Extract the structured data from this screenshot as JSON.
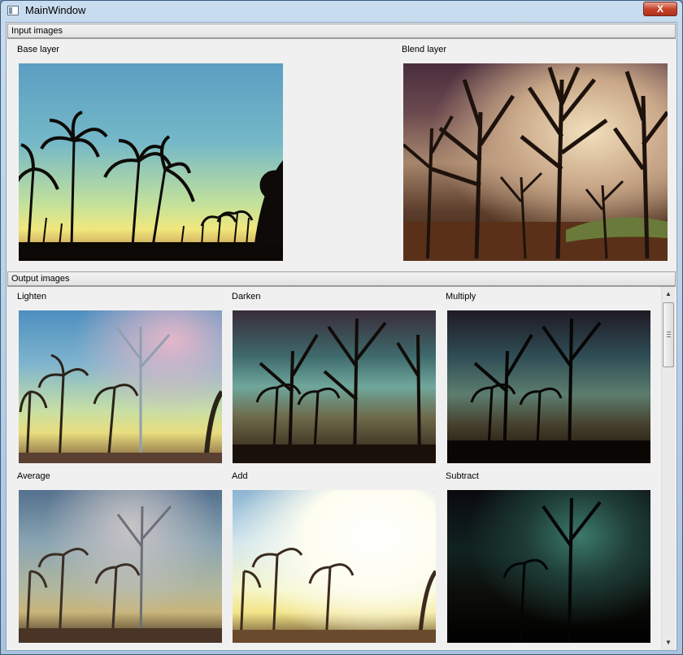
{
  "window": {
    "title": "MainWindow",
    "close_label": "X"
  },
  "input_section": {
    "header": "Input images",
    "base_label": "Base layer",
    "blend_label": "Blend layer"
  },
  "output_section": {
    "header": "Output images",
    "items": [
      {
        "label": "Lighten"
      },
      {
        "label": "Darken"
      },
      {
        "label": "Multiply"
      },
      {
        "label": "Average"
      },
      {
        "label": "Add"
      },
      {
        "label": "Subtract"
      }
    ]
  }
}
